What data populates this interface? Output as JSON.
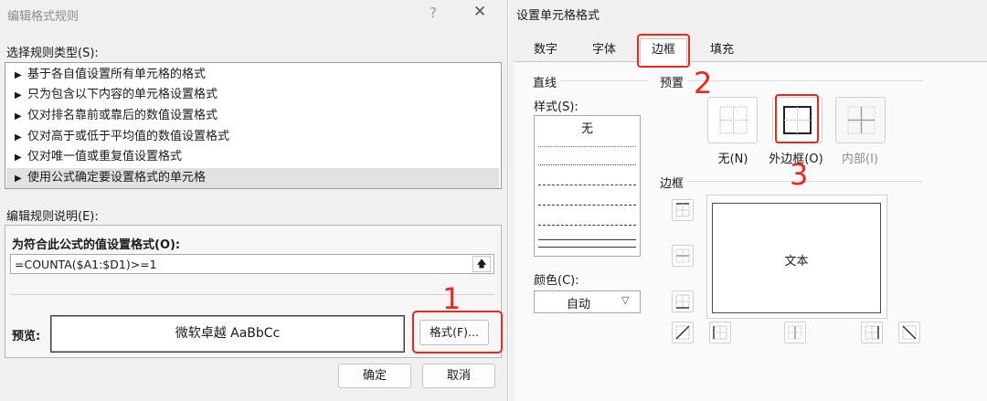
{
  "left_dialog": {
    "title": "编辑格式规则",
    "help_icon": "?",
    "close_icon": "✕",
    "select_label": "选择规则类型(S):",
    "rule_types": [
      {
        "label": "基于各自值设置所有单元格的格式",
        "selected": false
      },
      {
        "label": "只为包含以下内容的单元格设置格式",
        "selected": false
      },
      {
        "label": "仅对排名靠前或靠后的数值设置格式",
        "selected": false
      },
      {
        "label": "仅对高于或低于平均值的数值设置格式",
        "selected": false
      },
      {
        "label": "仅对唯一值或重复值设置格式",
        "selected": false
      },
      {
        "label": "使用公式确定要设置格式的单元格",
        "selected": true
      }
    ],
    "desc_label": "编辑规则说明(E):",
    "formula_heading": "为符合此公式的值设置格式(O):",
    "formula_value": "=COUNTA($A1:$D1)>=1",
    "preview_label": "预览:",
    "preview_text": "微软卓越  AaBbCc",
    "format_button": "格式(F)...",
    "ok_button": "确定",
    "cancel_button": "取消"
  },
  "right_dialog": {
    "title": "设置单元格格式",
    "tabs": [
      {
        "label": "数字",
        "active": false
      },
      {
        "label": "字体",
        "active": false
      },
      {
        "label": "边框",
        "active": true
      },
      {
        "label": "填充",
        "active": false
      }
    ],
    "line_group": "直线",
    "style_label": "样式(S):",
    "style_none": "无",
    "color_label": "颜色(C):",
    "color_value": "自动",
    "preset_group": "预置",
    "presets": [
      {
        "label": "无(N)",
        "icon": "border-none-icon"
      },
      {
        "label": "外边框(O)",
        "icon": "border-outline-icon"
      },
      {
        "label": "内部(I)",
        "icon": "border-inside-icon",
        "disabled": true
      }
    ],
    "border_group": "边框",
    "preview_text": "文本"
  },
  "annotations": [
    "1",
    "2",
    "3"
  ],
  "colors": {
    "annotation_red": "#e8291c",
    "dialog_bg": "#f0f0f0",
    "selected_row": "#e1e1e1"
  }
}
